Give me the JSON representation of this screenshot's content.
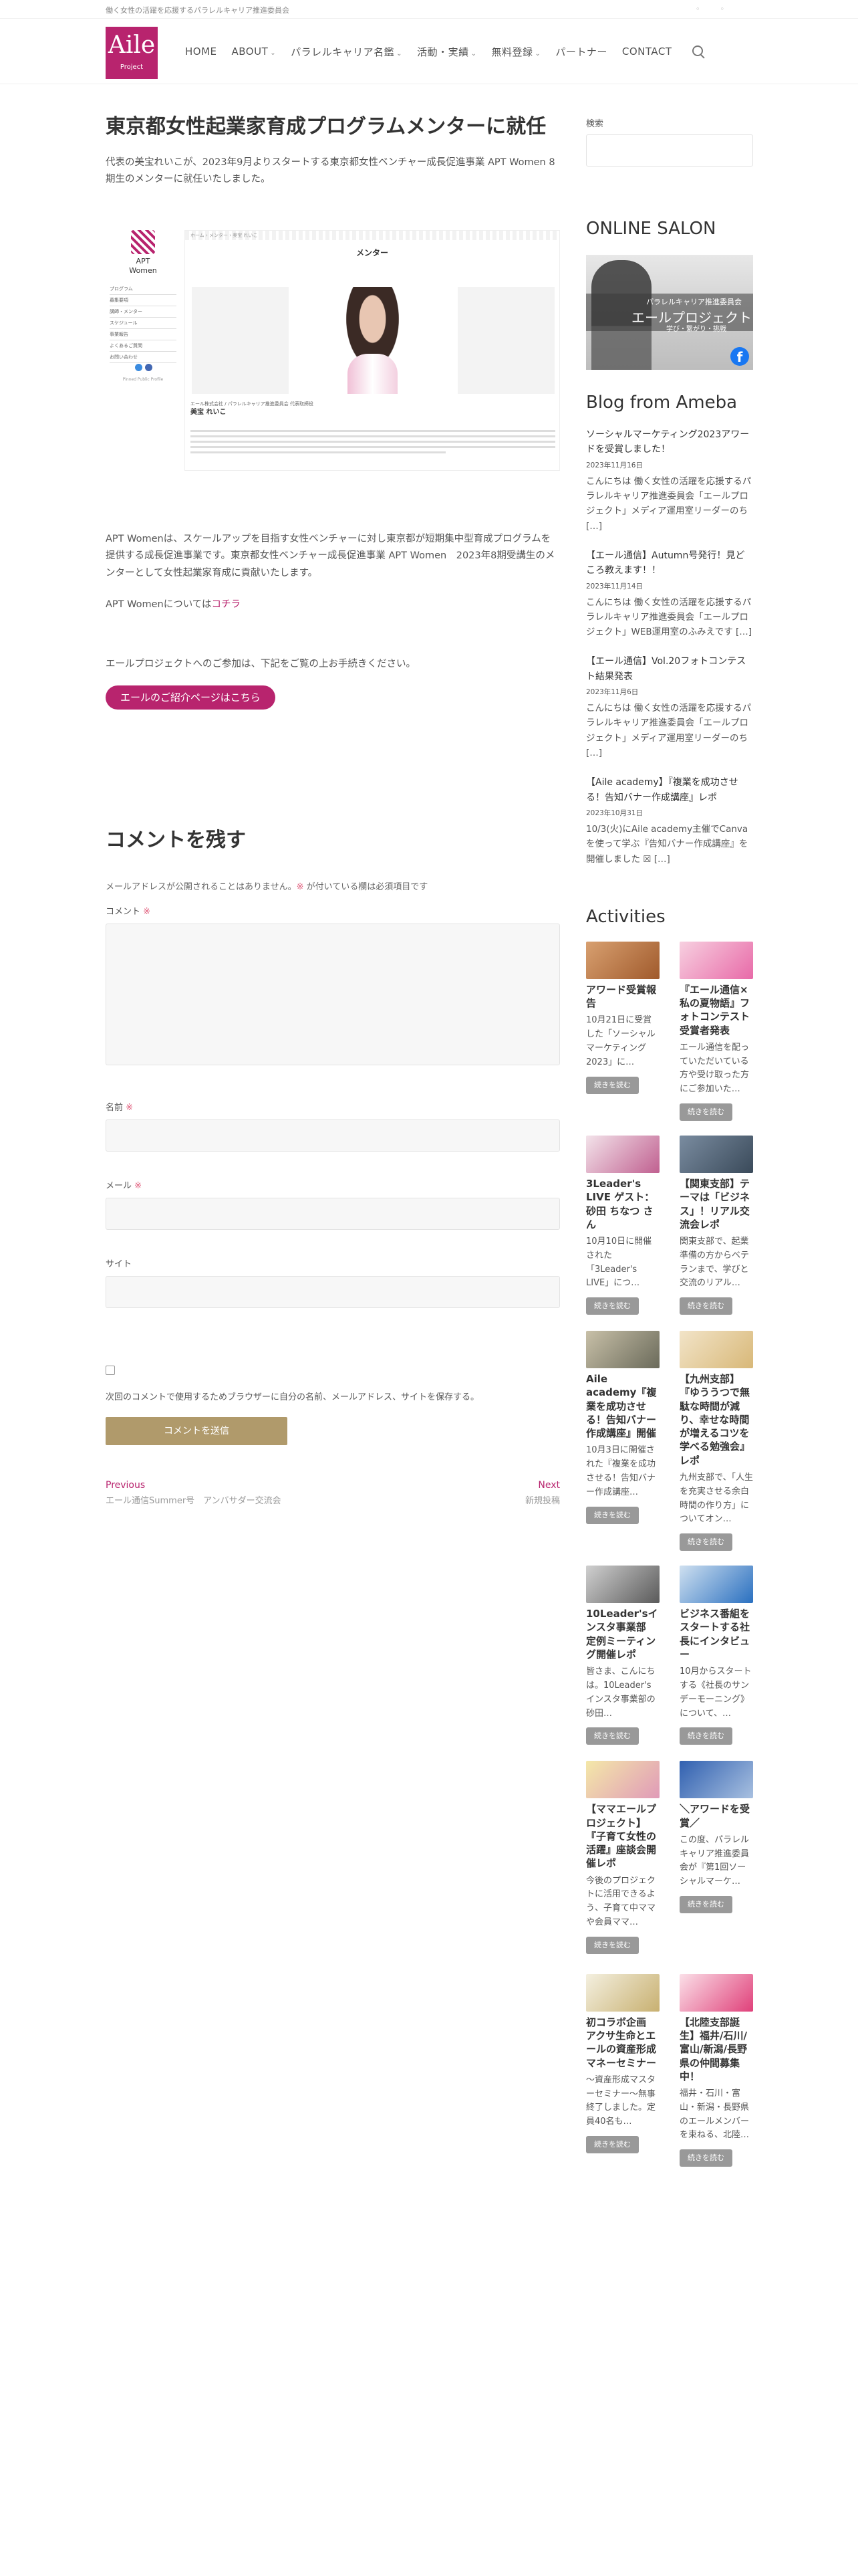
{
  "topbar": {
    "tagline": "働く女性の活躍を応援するパラレルキャリア推進委員会"
  },
  "logo": {
    "main": "Aile",
    "sub": "Project"
  },
  "nav": [
    {
      "label": "HOME",
      "dropdown": false
    },
    {
      "label": "ABOUT",
      "dropdown": true
    },
    {
      "label": "パラレルキャリア名鑑",
      "dropdown": true
    },
    {
      "label": "活動・実績",
      "dropdown": true
    },
    {
      "label": "無料登録",
      "dropdown": true
    },
    {
      "label": "パートナー",
      "dropdown": false
    },
    {
      "label": "CONTACT",
      "dropdown": false
    }
  ],
  "post": {
    "title": "東京都女性起業家育成プログラムメンターに就任",
    "p1": "代表の美宝れいこが、2023年9月よりスタートする東京都女性ベンチャー成長促進事業 APT Women 8 期生のメンターに就任いたしました。",
    "figure": {
      "brand": "APT",
      "brand2": "Women",
      "heading": "メンター",
      "crumb": "ホーム › メンター › 美宝 れいこ",
      "menu": [
        "プログラム",
        "募集要項",
        "講師・メンター",
        "スケジュール",
        "事業報告",
        "よくあるご質問",
        "お問い合わせ"
      ],
      "org": "エール株式会社 / パラレルキャリア推進委員会 代表取締役",
      "name": "美宝 れいこ",
      "footer": "Pinned Public Profile"
    },
    "p2": "APT Womenは、スケールアップを目指す女性ベンチャーに対し東京都が短期集中型育成プログラムを提供する成長促進事業です。東京都女性ベンチャー成長促進事業 APT Women　2023年8期受講生のメンターとして女性起業家育成に貢献いたします。",
    "p3_prefix": "APT Womenについては",
    "p3_link": "コチラ",
    "p4": "エールプロジェクトへのご参加は、下記をご覧の上お手続きください。",
    "cta": "エールのご紹介ページはこちら"
  },
  "comments": {
    "title": "コメントを残す",
    "note_prefix": "メールアドレスが公開されることはありません。",
    "note_mark": "※",
    "note_suffix": " が付いている欄は必須項目です",
    "comment_label": "コメント",
    "name_label": "名前",
    "email_label": "メール",
    "site_label": "サイト",
    "req_mark": "※",
    "save_text": "次回のコメントで使用するためブラウザーに自分の名前、メールアドレス、サイトを保存する。",
    "submit": "コメントを送信"
  },
  "postnav": {
    "prev_label": "Previous",
    "prev_title": "エール通信Summer号　アンバサダー交流会",
    "next_label": "Next",
    "next_title": "新規投稿"
  },
  "sidebar": {
    "search_label": "検索",
    "online_salon": "ONLINE SALON",
    "salon_image": {
      "line1": "パラレルキャリア推進委員会",
      "line2": "エールプロジェクト",
      "line3": "学び・繋がり・挑戦"
    },
    "blog_title": "Blog from Ameba",
    "blog": [
      {
        "title": "ソーシャルマーケティング2023アワードを受賞しました！",
        "date": "2023年11月16日",
        "excerpt": "こんにちは 働く女性の活躍を応援するパラレルキャリア推進委員会「エールプロジェクト」メディア運用室リーダーのち",
        "more": "[…]"
      },
      {
        "title": "【エール通信】Autumn号発行！見どころ教えます！！",
        "date": "2023年11月14日",
        "excerpt": "こんにちは 働く女性の活躍を応援するパラレルキャリア推進委員会「エールプロジェクト」WEB運用室のふみえです",
        "more": "[…]"
      },
      {
        "title": "【エール通信】Vol.20フォトコンテスト結果発表",
        "date": "2023年11月6日",
        "excerpt": "こんにちは 働く女性の活躍を応援するパラレルキャリア推進委員会「エールプロジェクト」メディア運用室リーダーのち",
        "more": "[…]"
      },
      {
        "title": "【Aile academy】『複業を成功させる！告知バナー作成講座』レポ",
        "date": "2023年10月31日",
        "excerpt": "10/3(火)にAile academy主催でCanvaを使って学ぶ『告知バナー作成講座』を開催しました ☒",
        "more": "[…]"
      }
    ],
    "activities_title": "Activities",
    "activities": [
      {
        "title": "アワード受賞報告",
        "excerpt": "10月21日に受賞した「ソーシャルマーケティング2023」に…",
        "more": "続きを読む",
        "colors": [
          "#d8a070",
          "#a05a2c"
        ]
      },
      {
        "title": "『エール通信×私の夏物語』フォトコンテスト受賞者発表",
        "excerpt": "エール通信を配っていただいている方や受け取った方にご参加いた…",
        "more": "続きを読む",
        "colors": [
          "#f7d0e0",
          "#e86aa8"
        ]
      },
      {
        "title": "3Leader's LIVE ゲスト：砂田 ちなつ さん",
        "excerpt": "10月10日に開催された「3Leader's LIVE」につ…",
        "more": "続きを読む",
        "colors": [
          "#f3e3ea",
          "#c06090"
        ]
      },
      {
        "title": "【関東支部】テーマは「ビジネス」！リアル交流会レポ",
        "excerpt": "関東支部で、起業準備の方からベテランまで、学びと交流のリアル…",
        "more": "続きを読む",
        "colors": [
          "#7a8ca0",
          "#3a4a5a"
        ]
      },
      {
        "title": "Aile academy『複業を成功させる！告知バナー作成講座』開催",
        "excerpt": "10月3日に開催された『複業を成功させる！告知バナー作成講座…",
        "more": "続きを読む",
        "colors": [
          "#c8c0a8",
          "#6a6a5a"
        ]
      },
      {
        "title": "【九州支部】『ゆううつで無駄な時間が減り、幸せな時間が増えるコツを学べる勉強会』レポ",
        "excerpt": "九州支部で、「人生を充実させる余白時間の作り方」についてオン…",
        "more": "続きを読む",
        "colors": [
          "#f2e4c8",
          "#d8b878"
        ]
      },
      {
        "title": "10Leader'sインスタ事業部　定例ミーティング開催レポ",
        "excerpt": "皆さま、こんにちは。10Leader'sインスタ事業部の砂田…",
        "more": "続きを読む",
        "colors": [
          "#d0d0d0",
          "#5a5a5a"
        ]
      },
      {
        "title": "ビジネス番組をスタートする社長にインタビュー",
        "excerpt": "10月からスタートする《社長のサンデーモーニング》について、…",
        "more": "続きを読む",
        "colors": [
          "#cfe0f0",
          "#2a70c0"
        ]
      },
      {
        "title": "【ママエールプロジェクト】『子育て女性の活躍』座談会開催レポ",
        "excerpt": "今後のプロジェクトに活用できるよう、子育て中ママや会員ママ…",
        "more": "続きを読む",
        "colors": [
          "#f4e8a8",
          "#e09ab8"
        ]
      },
      {
        "title": "＼アワードを受賞／",
        "excerpt": "この度、パラレルキャリア推進委員会が『第1回ソーシャルマーケ…",
        "more": "続きを読む",
        "colors": [
          "#3060b0",
          "#a8c0e0"
        ]
      },
      {
        "title": "初コラボ企画 アクサ生命とエールの資産形成マネーセミナー",
        "excerpt": "～資産形成マスターセミナー～無事終了しました。定員40名も…",
        "more": "続きを読む",
        "colors": [
          "#f4f0e0",
          "#c8b070"
        ]
      },
      {
        "title": "【北陸支部誕生】福井/石川/富山/新潟/長野県の仲間募集中！",
        "excerpt": "福井・石川・富山・新潟・長野県のエールメンバーを束ねる、北陸…",
        "more": "続きを読む",
        "colors": [
          "#fbe0e8",
          "#e0407a"
        ]
      }
    ]
  }
}
